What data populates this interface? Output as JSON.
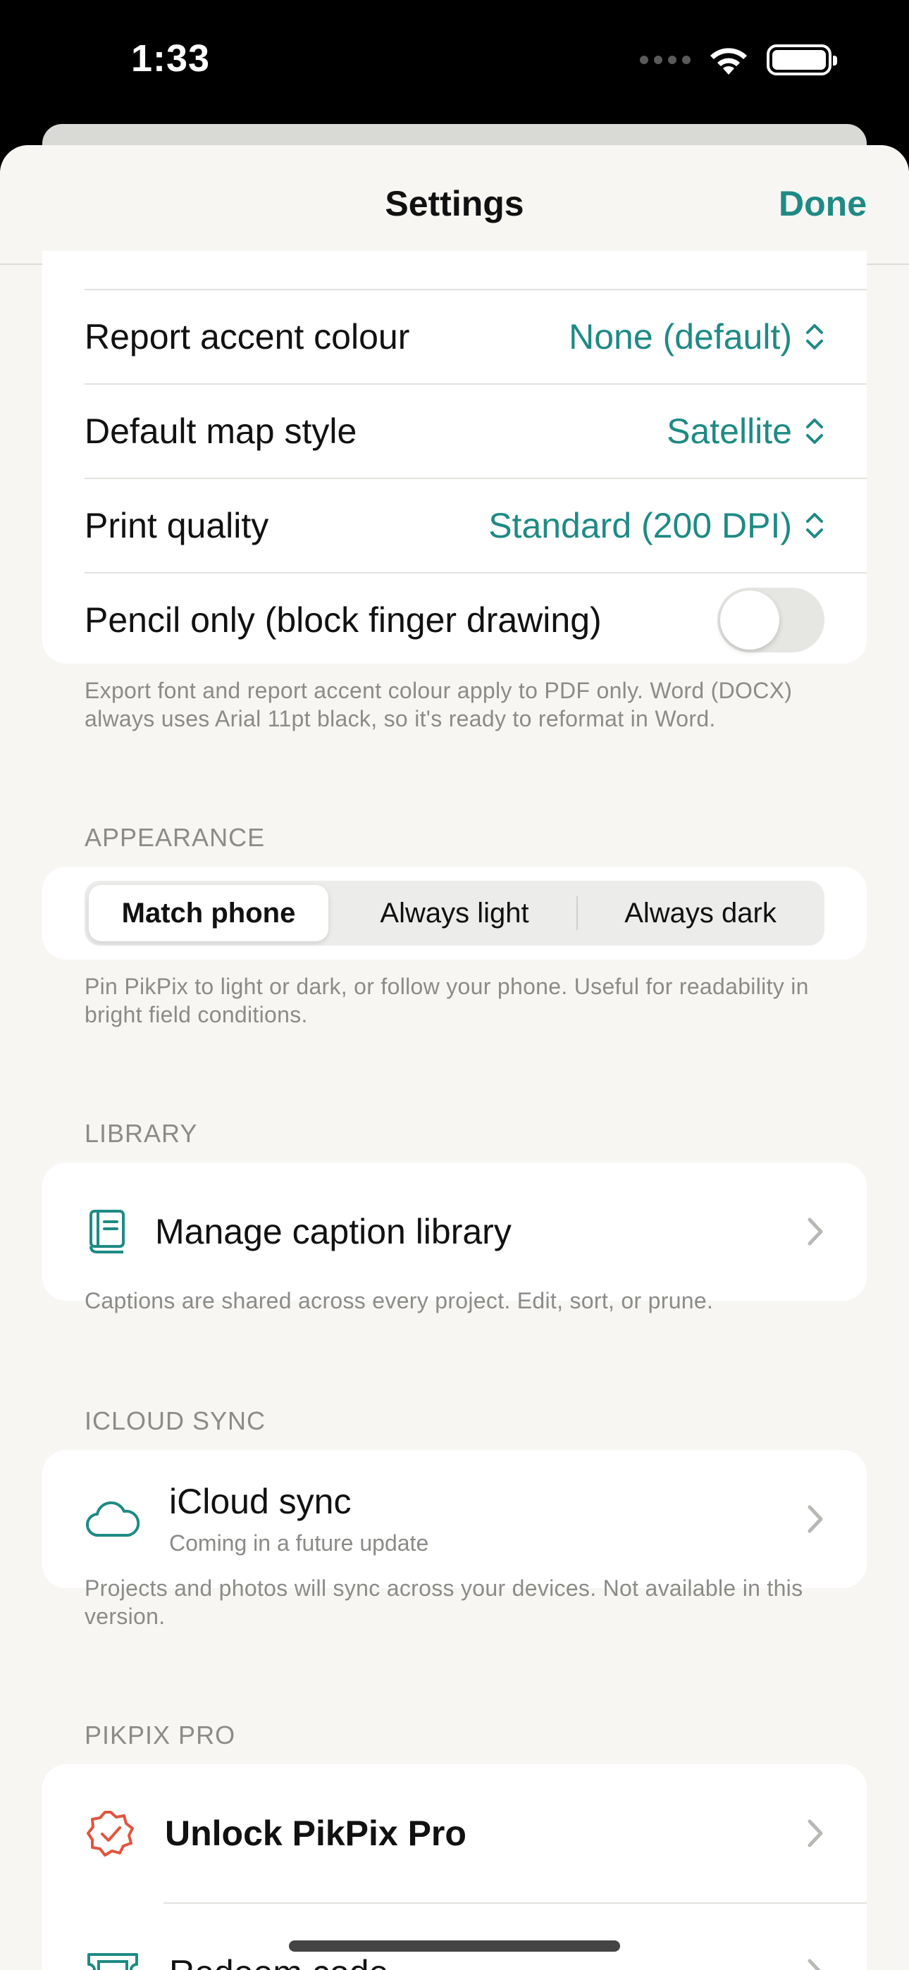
{
  "status_bar": {
    "time": "1:33"
  },
  "nav": {
    "title": "Settings",
    "done_label": "Done"
  },
  "export_section": {
    "rows": [
      {
        "label": "Report accent colour",
        "value": "None (default)"
      },
      {
        "label": "Default map style",
        "value": "Satellite"
      },
      {
        "label": "Print quality",
        "value": "Standard (200 DPI)"
      },
      {
        "label": "Pencil only (block finger drawing)",
        "toggle_on": false
      }
    ],
    "footnote": "Export font and report accent colour apply to PDF only. Word (DOCX) always uses Arial 11pt black, so it's ready to reformat in Word."
  },
  "appearance": {
    "header": "APPEARANCE",
    "options": [
      "Match phone",
      "Always light",
      "Always dark"
    ],
    "selected": "Match phone",
    "footnote": "Pin PikPix to light or dark, or follow your phone. Useful for readability in bright field conditions."
  },
  "library": {
    "header": "LIBRARY",
    "item_label": "Manage caption library",
    "footnote": "Captions are shared across every project. Edit, sort, or prune."
  },
  "icloud": {
    "header": "ICLOUD SYNC",
    "item_label": "iCloud sync",
    "item_subtitle": "Coming in a future update",
    "footnote": "Projects and photos will sync across your devices. Not available in this version."
  },
  "pro": {
    "header": "PIKPIX PRO",
    "unlock_label": "Unlock PikPix Pro",
    "redeem_label": "Redeem code"
  },
  "colors": {
    "accent": "#1f8a84",
    "pro_icon": "#e0553f",
    "background": "#f7f6f3"
  }
}
